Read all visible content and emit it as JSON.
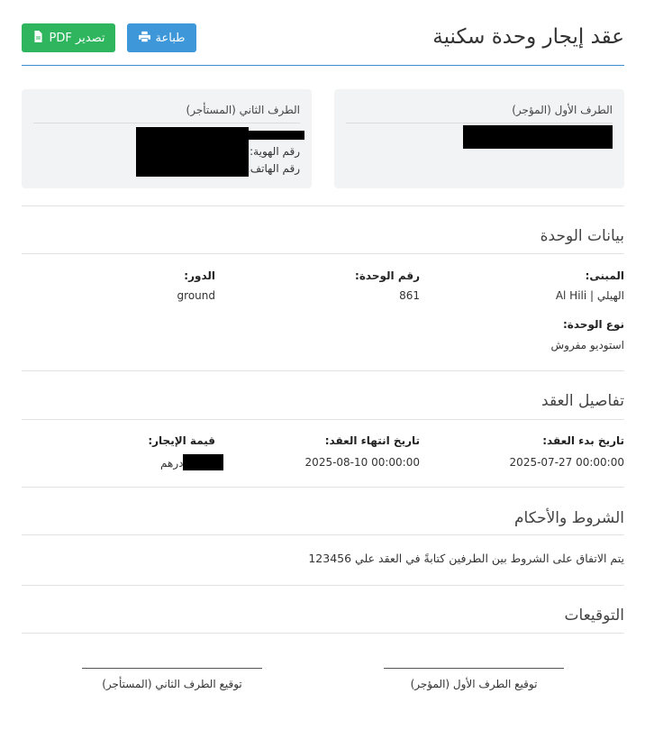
{
  "header": {
    "title": "عقد إيجار وحدة سكنية",
    "print_label": "طباعة",
    "export_label": "تصدير PDF"
  },
  "colors": {
    "primary": "#3d97d8",
    "success": "#2eb55e",
    "accent_line": "#3b8dce",
    "card_bg": "#f2f3f4"
  },
  "icons": {
    "print": "printer-icon",
    "export": "pdf-file-icon"
  },
  "parties": {
    "first": {
      "title": "الطرف الأول (المؤجر)"
    },
    "second": {
      "title": "الطرف الثاني (المستأجر)",
      "id_label": "رقم الهوية:",
      "phone_label": "رقم الهاتف:"
    }
  },
  "unit": {
    "section_title": "بيانات الوحدة",
    "building_label": "المبنى:",
    "building_value": "الهيلي | Al Hili",
    "unit_number_label": "رقم الوحدة:",
    "unit_number_value": "861",
    "floor_label": "الدور:",
    "floor_value": "ground",
    "type_label": "نوع الوحدة:",
    "type_value": "استوديو مفروش"
  },
  "contract": {
    "section_title": "تفاصيل العقد",
    "start_label": "تاريخ بدء العقد:",
    "start_value": "2025-07-27 00:00:00",
    "end_label": "تاريخ انتهاء العقد:",
    "end_value": "2025-08-10 00:00:00",
    "rent_label": "قيمة الإيجار:",
    "rent_currency": "درهم"
  },
  "terms": {
    "section_title": "الشروط والأحكام",
    "text": "يتم الاتفاق على الشروط بين الطرفين كتابةً في العقد علي 123456"
  },
  "signatures": {
    "section_title": "التوقيعات",
    "first_label": "توقيع الطرف الأول (المؤجر)",
    "second_label": "توقيع الطرف الثاني (المستأجر)"
  }
}
